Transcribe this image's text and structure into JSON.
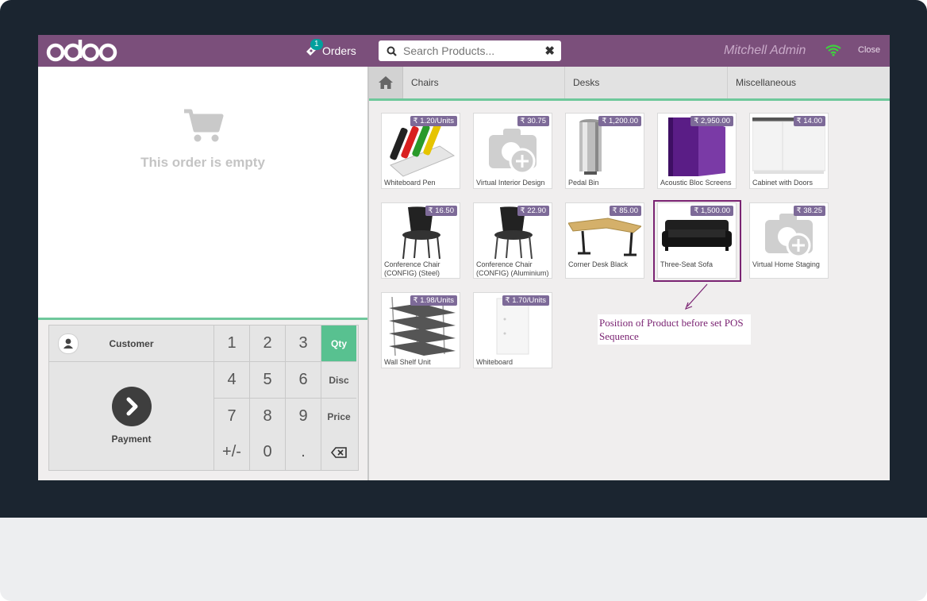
{
  "app": {
    "logo_text": "odoo",
    "user": "Mitchell Admin",
    "close_label": "Close"
  },
  "orders": {
    "label": "Orders",
    "count": "1"
  },
  "search": {
    "placeholder": "Search Products..."
  },
  "order_panel": {
    "empty_text": "This order is empty"
  },
  "numpad": {
    "customer_label": "Customer",
    "payment_label": "Payment",
    "keys": [
      "1",
      "2",
      "3",
      "4",
      "5",
      "6",
      "7",
      "8",
      "9",
      "+/-",
      "0",
      "."
    ],
    "modes": {
      "qty": "Qty",
      "disc": "Disc",
      "price": "Price"
    },
    "active_mode": "Qty"
  },
  "categories": [
    "Chairs",
    "Desks",
    "Miscellaneous"
  ],
  "products": [
    {
      "name": "Whiteboard Pen",
      "price": "₹ 1.20/Units"
    },
    {
      "name": "Virtual Interior Design",
      "price": "₹ 30.75"
    },
    {
      "name": "Pedal Bin",
      "price": "₹ 1,200.00"
    },
    {
      "name": "Acoustic Bloc Screens",
      "price": "₹ 2,950.00"
    },
    {
      "name": "Cabinet with Doors",
      "price": "₹ 14.00"
    },
    {
      "name": "Conference Chair (CONFIG) (Steel)",
      "price": "₹ 16.50"
    },
    {
      "name": "Conference Chair (CONFIG) (Aluminium)",
      "price": "₹ 22.90"
    },
    {
      "name": "Corner Desk Black",
      "price": "₹ 85.00"
    },
    {
      "name": "Three-Seat Sofa",
      "price": "₹ 1,500.00"
    },
    {
      "name": "Virtual Home Staging",
      "price": "₹ 38.25"
    },
    {
      "name": "Wall Shelf Unit",
      "price": "₹ 1.98/Units"
    },
    {
      "name": "Whiteboard",
      "price": "₹ 1.70/Units"
    }
  ],
  "annotation": {
    "text": "Position of Product before set POS Sequence"
  },
  "colors": {
    "topbar": "#7b4f7b",
    "accent": "#58c190",
    "price_tag": "#7d6a98",
    "annotation": "#7a2372"
  }
}
